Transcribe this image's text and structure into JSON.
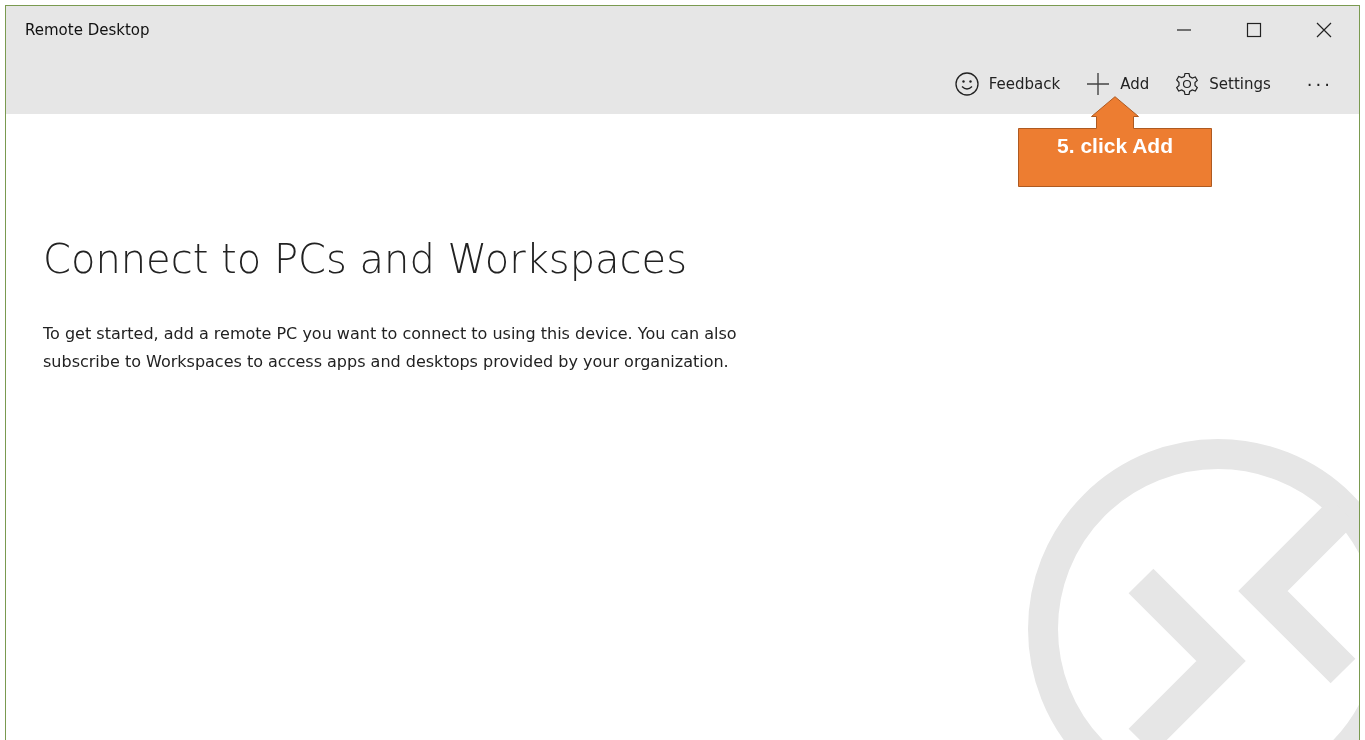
{
  "window": {
    "title": "Remote Desktop"
  },
  "toolbar": [
    {
      "kind": "feedback",
      "label": "Feedback"
    },
    {
      "kind": "add",
      "label": "Add"
    },
    {
      "kind": "settings",
      "label": "Settings"
    },
    {
      "kind": "more",
      "label": "···"
    }
  ],
  "content": {
    "heading": "Connect to PCs and Workspaces",
    "text": "To get started, add a remote PC you want to connect to using this device. You can also subscribe to Workspaces to access apps and desktops provided by your organization."
  },
  "callout": {
    "text": "5. click Add"
  }
}
